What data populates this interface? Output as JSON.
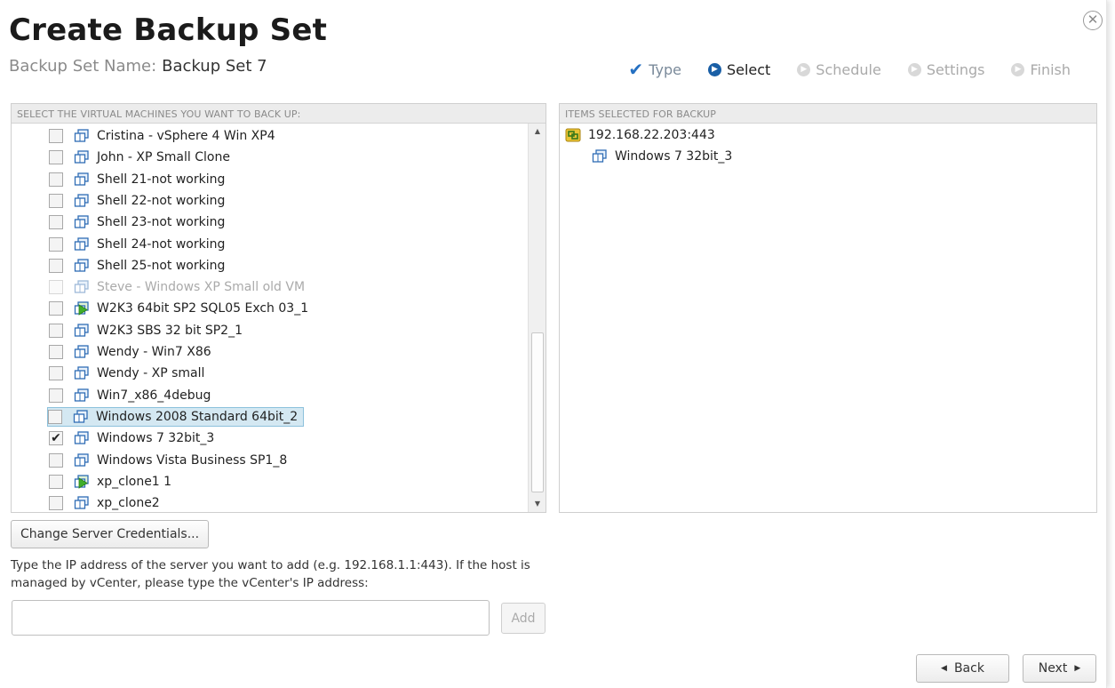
{
  "dialog": {
    "title": "Create Backup Set",
    "name_label": "Backup Set Name:",
    "name_value": "Backup Set 7",
    "close_glyph": "✕"
  },
  "steps": [
    {
      "label": "Type",
      "state": "done"
    },
    {
      "label": "Select",
      "state": "current"
    },
    {
      "label": "Schedule",
      "state": "pending"
    },
    {
      "label": "Settings",
      "state": "pending"
    },
    {
      "label": "Finish",
      "state": "pending"
    }
  ],
  "left_panel": {
    "header": "SELECT THE VIRTUAL MACHINES YOU WANT TO BACK UP:",
    "vms": [
      {
        "label": "Cristina - vSphere 4 Win XP4",
        "checked": false,
        "icon": "vm-icon"
      },
      {
        "label": "John - XP Small Clone",
        "checked": false,
        "icon": "vm-icon"
      },
      {
        "label": "Shell 21-not working",
        "checked": false,
        "icon": "vm-icon"
      },
      {
        "label": "Shell 22-not working",
        "checked": false,
        "icon": "vm-icon"
      },
      {
        "label": "Shell 23-not working",
        "checked": false,
        "icon": "vm-icon"
      },
      {
        "label": "Shell 24-not working",
        "checked": false,
        "icon": "vm-icon"
      },
      {
        "label": "Shell 25-not working",
        "checked": false,
        "icon": "vm-icon"
      },
      {
        "label": "Steve - Windows XP Small old VM",
        "checked": false,
        "icon": "vm-icon",
        "disabled": true
      },
      {
        "label": "W2K3 64bit SP2 SQL05 Exch 03_1",
        "checked": false,
        "icon": "vm-running-icon"
      },
      {
        "label": "W2K3 SBS 32 bit SP2_1",
        "checked": false,
        "icon": "vm-icon"
      },
      {
        "label": "Wendy - Win7 X86",
        "checked": false,
        "icon": "vm-icon"
      },
      {
        "label": "Wendy - XP small",
        "checked": false,
        "icon": "vm-icon"
      },
      {
        "label": "Win7_x86_4debug",
        "checked": false,
        "icon": "vm-icon"
      },
      {
        "label": "Windows 2008 Standard 64bit_2",
        "checked": false,
        "icon": "vm-icon",
        "selected": true
      },
      {
        "label": "Windows 7 32bit_3",
        "checked": true,
        "icon": "vm-icon"
      },
      {
        "label": "Windows Vista Business SP1_8",
        "checked": false,
        "icon": "vm-icon"
      },
      {
        "label": "xp_clone1 1",
        "checked": false,
        "icon": "vm-running-icon"
      },
      {
        "label": "xp_clone2",
        "checked": false,
        "icon": "vm-icon"
      }
    ]
  },
  "right_panel": {
    "header": "ITEMS SELECTED FOR BACKUP",
    "host": "192.168.22.203:443",
    "children": [
      "Windows 7 32bit_3"
    ]
  },
  "buttons": {
    "change_credentials": "Change Server Credentials...",
    "add": "Add",
    "back": "Back",
    "next": "Next"
  },
  "add_server": {
    "help_text": "Type the IP address of the server you want to add (e.g. 192.168.1.1:443). If the host is managed by vCenter, please type the vCenter's IP address:",
    "value": "",
    "placeholder": ""
  },
  "colors": {
    "accent": "#1a5fa6",
    "selection_bg": "#d4e8f2",
    "vm_icon": "#2f6db5",
    "host_icon": "#c9a21b"
  }
}
